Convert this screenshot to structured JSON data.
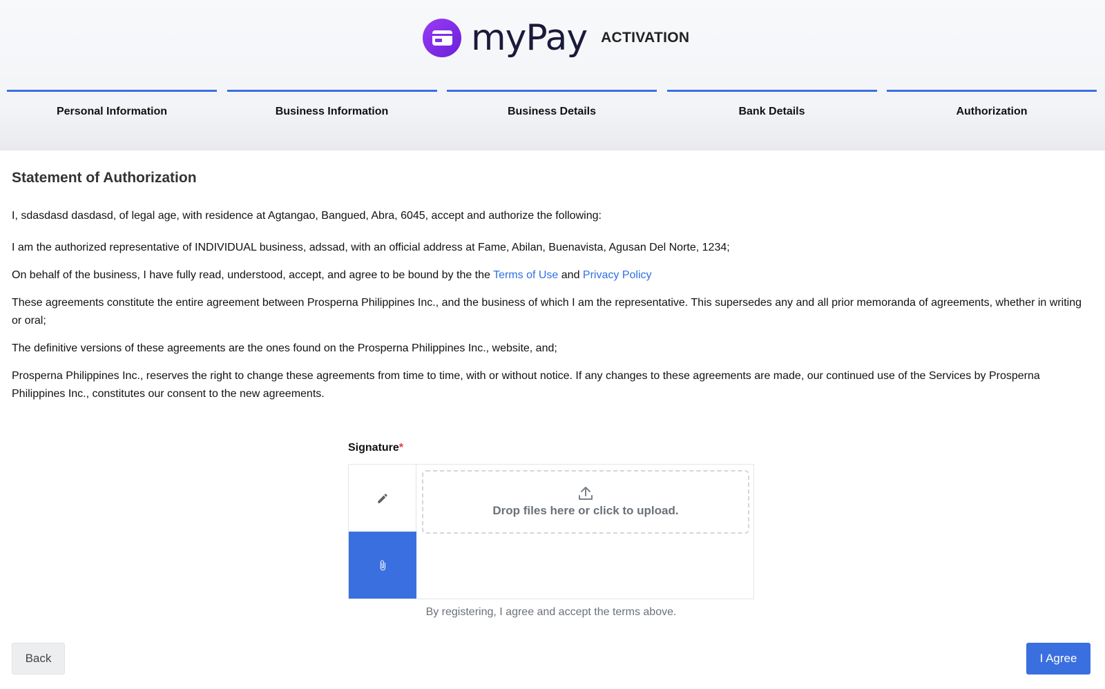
{
  "header": {
    "logo_text": "myPay",
    "title": "ACTIVATION"
  },
  "steps": [
    {
      "label": "Personal Information"
    },
    {
      "label": "Business Information"
    },
    {
      "label": "Business Details"
    },
    {
      "label": "Bank Details"
    },
    {
      "label": "Authorization"
    }
  ],
  "statement": {
    "heading": "Statement of Authorization",
    "p1": "I, sdasdasd dasdasd, of legal age, with residence at Agtangao, Bangued, Abra, 6045, accept and authorize the following:",
    "p2": "I am the authorized representative of INDIVIDUAL business, adssad, with an official address at Fame, Abilan, Buenavista, Agusan Del Norte, 1234;",
    "p3_prefix": "On behalf of the business, I have fully read, understood, accept, and agree to be bound by the the ",
    "terms_link": "Terms of Use",
    "p3_and": " and ",
    "privacy_link": "Privacy Policy",
    "p4": "These agreements constitute the entire agreement between Prosperna Philippines Inc., and the business of which I am the representative. This supersedes any and all prior memoranda of agreements, whether in writing or oral;",
    "p5": "The definitive versions of these agreements are the ones found on the Prosperna Philippines Inc., website, and;",
    "p6": "Prosperna Philippines Inc., reserves the right to change these agreements from time to time, with or without notice. If any changes to these agreements are made, our continued use of the Services by Prosperna Philippines Inc., constitutes our consent to the new agreements."
  },
  "signature": {
    "label": "Signature",
    "required_mark": "*",
    "dropzone_text": "Drop files here or click to upload.",
    "agree_note": "By registering, I agree and accept the terms above.",
    "tab_draw_icon": "pencil-icon",
    "tab_upload_icon": "paperclip-icon"
  },
  "actions": {
    "back_label": "Back",
    "agree_label": "I Agree"
  },
  "colors": {
    "accent": "#3a6fe0",
    "brand": "#7f2ee6",
    "link": "#2f6fe2",
    "required": "#e53935"
  }
}
